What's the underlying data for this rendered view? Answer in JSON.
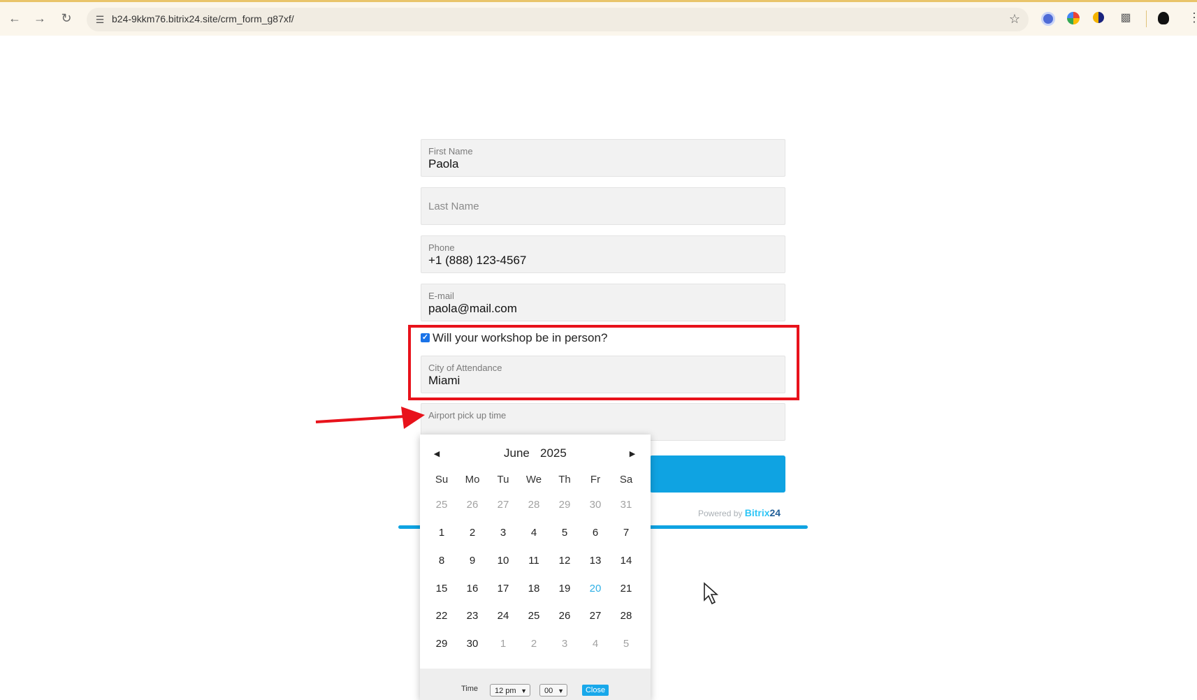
{
  "browser": {
    "url": "b24-9kkm76.bitrix24.site/crm_form_g87xf/"
  },
  "form": {
    "first_name": {
      "label": "First Name",
      "value": "Paola"
    },
    "last_name": {
      "placeholder": "Last Name"
    },
    "phone": {
      "label": "Phone",
      "value": "+1 (888) 123-4567"
    },
    "email": {
      "label": "E-mail",
      "value": "paola@mail.com"
    },
    "in_person": {
      "label": "Will your workshop be in person?",
      "checked": true
    },
    "city": {
      "label": "City of Attendance",
      "value": "Miami"
    },
    "airport": {
      "label": "Airport pick up time"
    },
    "powered_prefix": "Powered by",
    "brand_part1": "Bitrix",
    "brand_part2": "24",
    "accent_color": "#0fa3e2",
    "highlight_color": "#e8121b"
  },
  "calendar": {
    "month": "June",
    "year": "2025",
    "weekdays": [
      "Su",
      "Mo",
      "Tu",
      "We",
      "Th",
      "Fr",
      "Sa"
    ],
    "weeks": [
      [
        "25",
        "26",
        "27",
        "28",
        "29",
        "30",
        "31"
      ],
      [
        "1",
        "2",
        "3",
        "4",
        "5",
        "6",
        "7"
      ],
      [
        "8",
        "9",
        "10",
        "11",
        "12",
        "13",
        "14"
      ],
      [
        "15",
        "16",
        "17",
        "18",
        "19",
        "20",
        "21"
      ],
      [
        "22",
        "23",
        "24",
        "25",
        "26",
        "27",
        "28"
      ],
      [
        "29",
        "30",
        "1",
        "2",
        "3",
        "4",
        "5"
      ]
    ],
    "time_label": "Time",
    "hour": "12 pm",
    "minute": "00",
    "close_label": "Close"
  }
}
